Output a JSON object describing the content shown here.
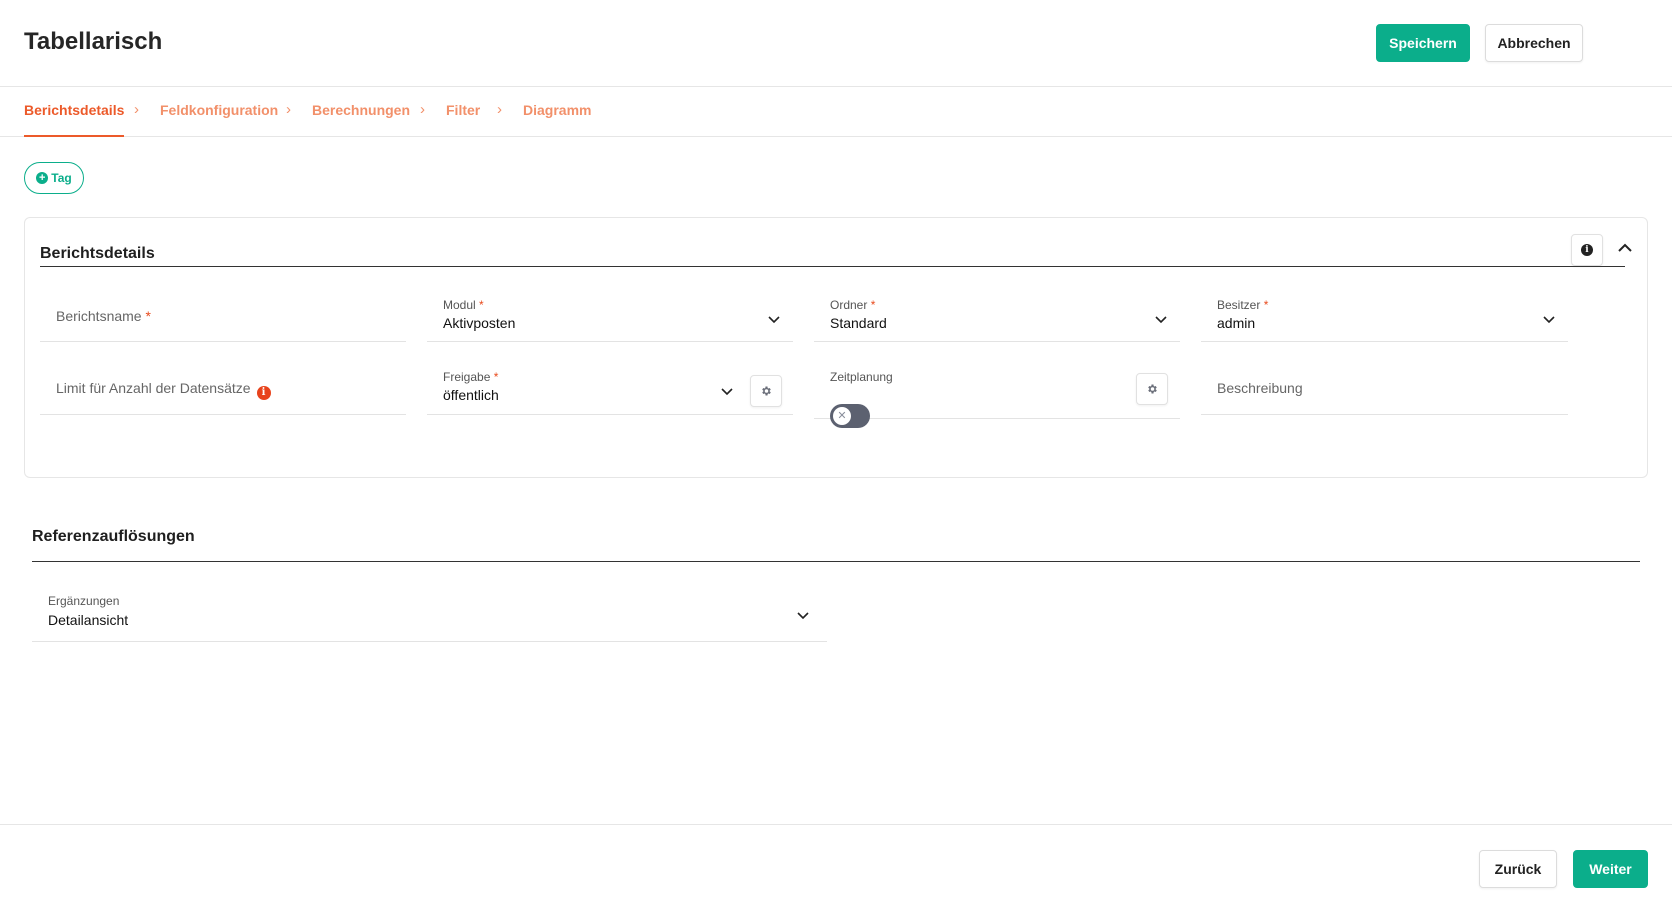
{
  "header": {
    "title": "Tabellarisch",
    "save_label": "Speichern",
    "cancel_label": "Abbrechen"
  },
  "tabs": [
    {
      "label": "Berichtsdetails",
      "active": true
    },
    {
      "label": "Feldkonfiguration",
      "active": false
    },
    {
      "label": "Berechnungen",
      "active": false
    },
    {
      "label": "Filter",
      "active": false
    },
    {
      "label": "Diagramm",
      "active": false
    }
  ],
  "tag_button": {
    "label": "Tag",
    "icon": "plus-circle-icon"
  },
  "details_section": {
    "title": "Berichtsdetails",
    "fields": {
      "report_name": {
        "placeholder": "Berichtsname",
        "required": "*"
      },
      "module": {
        "label": "Modul",
        "required": "*",
        "value": "Aktivposten"
      },
      "folder": {
        "label": "Ordner",
        "required": "*",
        "value": "Standard"
      },
      "owner": {
        "label": "Besitzer",
        "required": "*",
        "value": "admin"
      },
      "record_limit": {
        "placeholder": "Limit für Anzahl der Datensätze",
        "info": "i"
      },
      "sharing": {
        "label": "Freigabe",
        "required": "*",
        "value": "öffentlich"
      },
      "scheduling": {
        "label": "Zeitplanung",
        "enabled": false
      },
      "description": {
        "placeholder": "Beschreibung"
      }
    }
  },
  "reference_section": {
    "title": "Referenzauflösungen",
    "additions": {
      "label": "Ergänzungen",
      "value": "Detailansicht"
    }
  },
  "footer": {
    "back_label": "Zurück",
    "next_label": "Weiter"
  },
  "colors": {
    "primary": "#0bae8b",
    "accent": "#ec5a2a",
    "required": "#e84a1c"
  }
}
